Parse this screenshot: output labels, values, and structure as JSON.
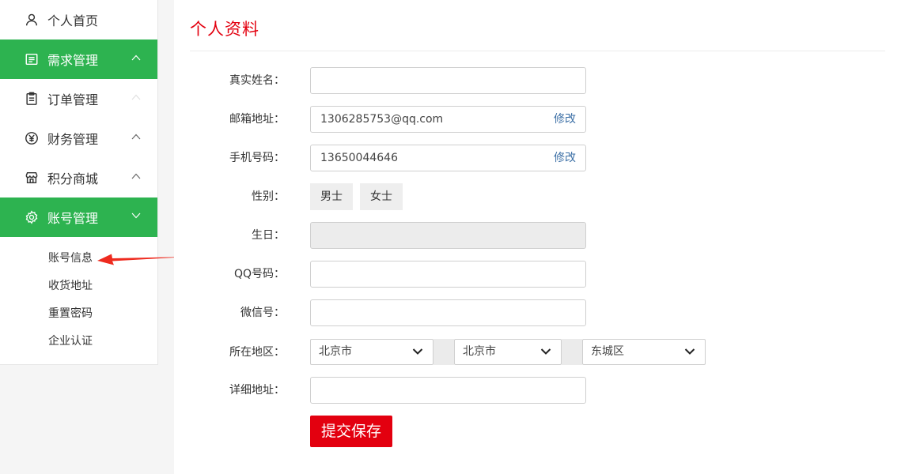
{
  "sidebar": {
    "items": [
      {
        "label": "个人首页",
        "icon": "user-icon"
      },
      {
        "label": "需求管理",
        "icon": "list-icon",
        "chevron": "up"
      },
      {
        "label": "订单管理",
        "icon": "clipboard-icon",
        "chevron": "up"
      },
      {
        "label": "财务管理",
        "icon": "yen-icon",
        "chevron": "up"
      },
      {
        "label": "积分商城",
        "icon": "store-icon",
        "chevron": "up"
      },
      {
        "label": "账号管理",
        "icon": "gear-icon",
        "chevron": "down"
      }
    ],
    "sub_items": [
      "账号信息",
      "收货地址",
      "重置密码",
      "企业认证"
    ]
  },
  "main": {
    "title": "个人资料",
    "form": {
      "real_name_label": "真实姓名：",
      "real_name_value": "",
      "email_label": "邮箱地址：",
      "email_value": "1306285753@qq.com",
      "email_modify": "修改",
      "phone_label": "手机号码：",
      "phone_value": "13650044646",
      "phone_modify": "修改",
      "gender_label": "性别：",
      "gender_male": "男士",
      "gender_female": "女士",
      "birthday_label": "生日：",
      "birthday_value": "",
      "qq_label": "QQ号码：",
      "qq_value": "",
      "wechat_label": "微信号：",
      "wechat_value": "",
      "region_label": "所在地区：",
      "province": "北京市",
      "city": "北京市",
      "district": "东城区",
      "address_label": "详细地址：",
      "address_value": "",
      "submit_label": "提交保存"
    }
  },
  "colors": {
    "accent_green": "#2db350",
    "brand_red": "#e3000f",
    "link_blue": "#3a6ea5"
  }
}
